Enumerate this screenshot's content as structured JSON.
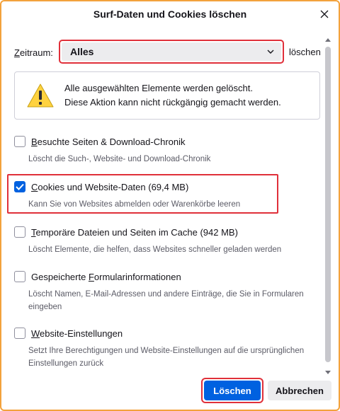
{
  "dialog": {
    "title": "Surf-Daten und Cookies löschen",
    "close_icon": "close-icon"
  },
  "range": {
    "label_prefix": "",
    "label_access": "Z",
    "label_rest": "eitraum:",
    "selected": "Alles",
    "suffix": "löschen"
  },
  "warning": {
    "icon": "warning-icon",
    "line1": "Alle ausgewählten Elemente werden gelöscht.",
    "line2": "Diese Aktion kann nicht rückgängig gemacht werden."
  },
  "options": [
    {
      "access": "B",
      "label_rest": "esuchte Seiten & Download-Chronik",
      "checked": false,
      "description": "Löscht die Such-, Website- und Download-Chronik"
    },
    {
      "access": "C",
      "label_rest": "ookies und Website-Daten (69,4 MB)",
      "checked": true,
      "description": "Kann Sie von Websites abmelden oder Warenkörbe leeren"
    },
    {
      "access": "T",
      "label_rest": "emporäre Dateien und Seiten im Cache (942 MB)",
      "checked": false,
      "description": "Löscht Elemente, die helfen, dass Websites schneller geladen werden"
    },
    {
      "pre": "Gespeicherte ",
      "access": "F",
      "label_rest": "ormularinformationen",
      "checked": false,
      "description": "Löscht Namen, E-Mail-Adressen und andere Einträge, die Sie in Formularen eingeben"
    },
    {
      "access": "W",
      "label_rest": "ebsite-Einstellungen",
      "checked": false,
      "description": "Setzt Ihre Berechtigungen und Website-Einstellungen auf die ursprünglichen Einstellungen zurück"
    }
  ],
  "buttons": {
    "primary": "Löschen",
    "secondary": "Abbrechen"
  },
  "colors": {
    "accent": "#0061e0",
    "highlight": "#e0303a",
    "window_border": "#f3a23c"
  }
}
